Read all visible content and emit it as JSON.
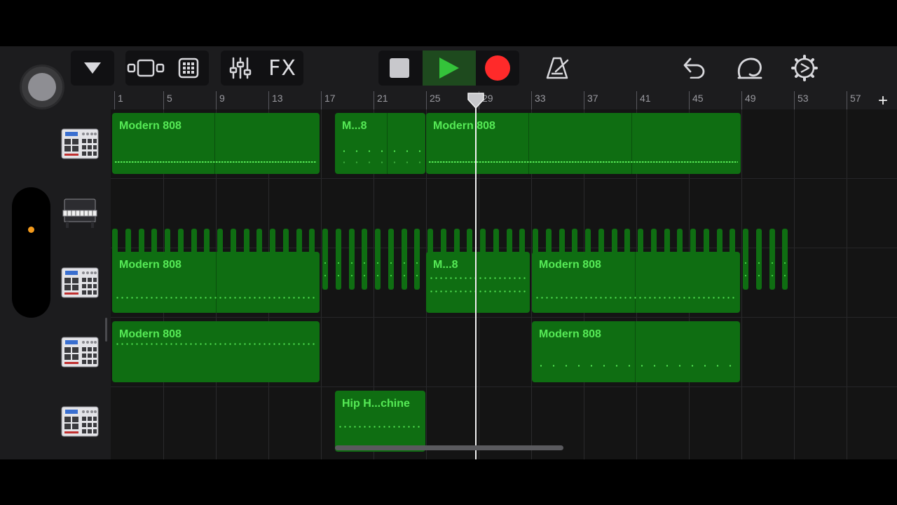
{
  "toolbar": {
    "fx_label": "FX",
    "colors": {
      "play": "#34c33a",
      "record": "#ff2a2a",
      "play_bg": "#1e4a1e"
    }
  },
  "ruler": {
    "bars": [
      "1",
      "5",
      "9",
      "13",
      "17",
      "21",
      "25",
      "29",
      "33",
      "37",
      "41",
      "45",
      "49",
      "53",
      "57"
    ],
    "add_label": "+"
  },
  "tracks": [
    {
      "instrument": "drum-machine-icon",
      "regions": [
        {
          "label": "Modern 808",
          "pattern": "dense"
        },
        {
          "label": "M...8",
          "pattern": "sparse"
        },
        {
          "label": "Modern 808",
          "pattern": "dense"
        }
      ]
    },
    {
      "instrument": "piano-icon",
      "regions": []
    },
    {
      "instrument": "drum-machine-icon",
      "regions": [
        {
          "label": "Modern 808",
          "pattern": "dots"
        },
        {
          "label": "M...8",
          "pattern": "dots"
        },
        {
          "label": "Modern 808",
          "pattern": "dots"
        }
      ]
    },
    {
      "instrument": "drum-machine-icon",
      "regions": [
        {
          "label": "Modern 808",
          "pattern": "dots"
        },
        {
          "label": "Modern 808",
          "pattern": "sparse"
        }
      ]
    },
    {
      "instrument": "drum-machine-icon",
      "regions": [
        {
          "label": "Hip H...chine",
          "pattern": "dots"
        }
      ]
    }
  ],
  "colors": {
    "region_fill": "#0f6e12",
    "region_text": "#56ea56",
    "playhead": "#f2f2f2",
    "side_dot": "#f39a1c"
  }
}
